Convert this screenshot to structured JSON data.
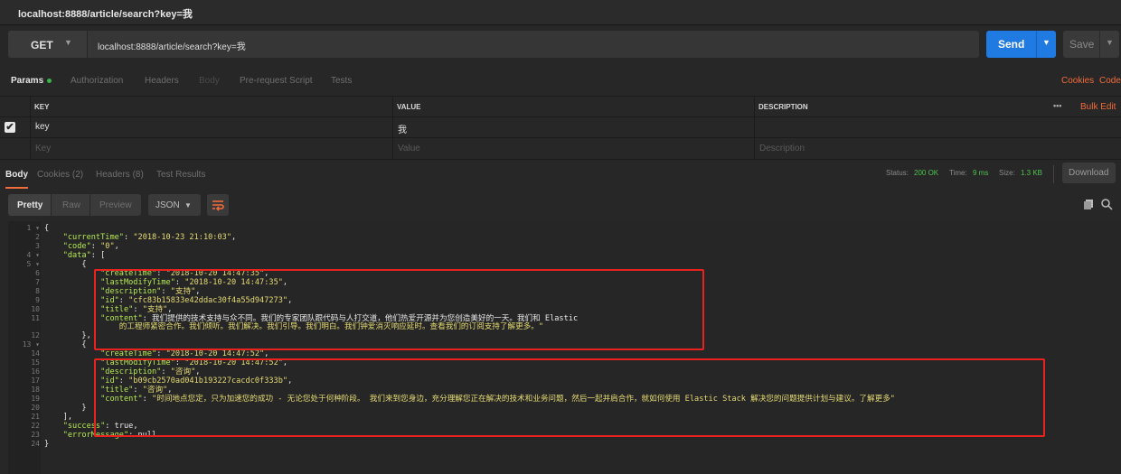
{
  "window": {
    "title": "localhost:8888/article/search?key=我"
  },
  "request": {
    "method": "GET",
    "url": "localhost:8888/article/search?key=我",
    "send_label": "Send",
    "save_label": "Save"
  },
  "request_tabs": [
    {
      "label": "Params"
    },
    {
      "label": "Authorization"
    },
    {
      "label": "Headers"
    },
    {
      "label": "Body"
    },
    {
      "label": "Pre-request Script"
    },
    {
      "label": "Tests"
    }
  ],
  "request_links": {
    "cookies": "Cookies",
    "code": "Code"
  },
  "params": {
    "headers": {
      "key": "KEY",
      "value": "VALUE",
      "description": "DESCRIPTION"
    },
    "more": "•••",
    "bulk_edit": "Bulk Edit",
    "rows": [
      {
        "key": "key",
        "value": "我",
        "description": "",
        "checked": true
      }
    ],
    "placeholder": {
      "key": "Key",
      "value": "Value",
      "description": "Description"
    }
  },
  "response_tabs": [
    {
      "label": "Body"
    },
    {
      "label": "Cookies (2)"
    },
    {
      "label": "Headers (8)"
    },
    {
      "label": "Test Results"
    }
  ],
  "status": {
    "status_label": "Status:",
    "status_value": "200 OK",
    "time_label": "Time:",
    "time_value": "9 ms",
    "size_label": "Size:",
    "size_value": "1.3 KB",
    "download": "Download"
  },
  "view": {
    "pretty": "Pretty",
    "raw": "Raw",
    "preview": "Preview",
    "format": "JSON"
  },
  "editor": {
    "lines": [
      "{",
      "    \"currentTime\": \"2018-10-23 21:10:03\",",
      "    \"code\": \"0\",",
      "    \"data\": [",
      "        {",
      "            \"createTime\": \"2018-10-20 14:47:35\",",
      "            \"lastModifyTime\": \"2018-10-20 14:47:35\",",
      "            \"description\": \"支持\",",
      "            \"id\": \"cfc83b15833e42ddac30f4a55d947273\",",
      "            \"title\": \"支持\",",
      "            \"content\": \"我们提供的技术支持与众不同。我们的专家团队跟代码与人打交道，他们热爱开源并为您创造美好的一天。我们和 Elastic",
      "                的工程师紧密合作。我们倾听。我们解决。我们引导。我们明白。我们钟爱消灭响应延时。查看我们的订阅支持了解更多。\"",
      "        },",
      "        {",
      "            \"createTime\": \"2018-10-20 14:47:52\",",
      "            \"lastModifyTime\": \"2018-10-20 14:47:52\",",
      "            \"description\": \"咨询\",",
      "            \"id\": \"b09cb2570ad041b193227cacdc0f333b\",",
      "            \"title\": \"咨询\",",
      "            \"content\": \"时间地点您定，只为加速您的成功 - 无论您处于何种阶段。 我们来到您身边，充分理解您正在解决的技术和业务问题，然后一起并肩合作，就如何使用 Elastic Stack 解决您的问题提供计划与建议。了解更多\"",
      "        }",
      "    ],",
      "    \"success\": true,",
      "    \"errorMessage\": null",
      "}"
    ],
    "line_numbers": [
      "1",
      "2",
      "3",
      "4",
      "5",
      "6",
      "7",
      "8",
      "9",
      "10",
      "11",
      "",
      "12",
      "13",
      "14",
      "15",
      "16",
      "17",
      "18",
      "19",
      "20",
      "21",
      "22",
      "23",
      "24"
    ]
  },
  "colors": {
    "send": "#1f7ae2",
    "highlight": "#e8231f",
    "status_ok": "#4fc34f",
    "accent": "#f26b3a",
    "key": "#b5e853",
    "string": "#e6db74"
  }
}
